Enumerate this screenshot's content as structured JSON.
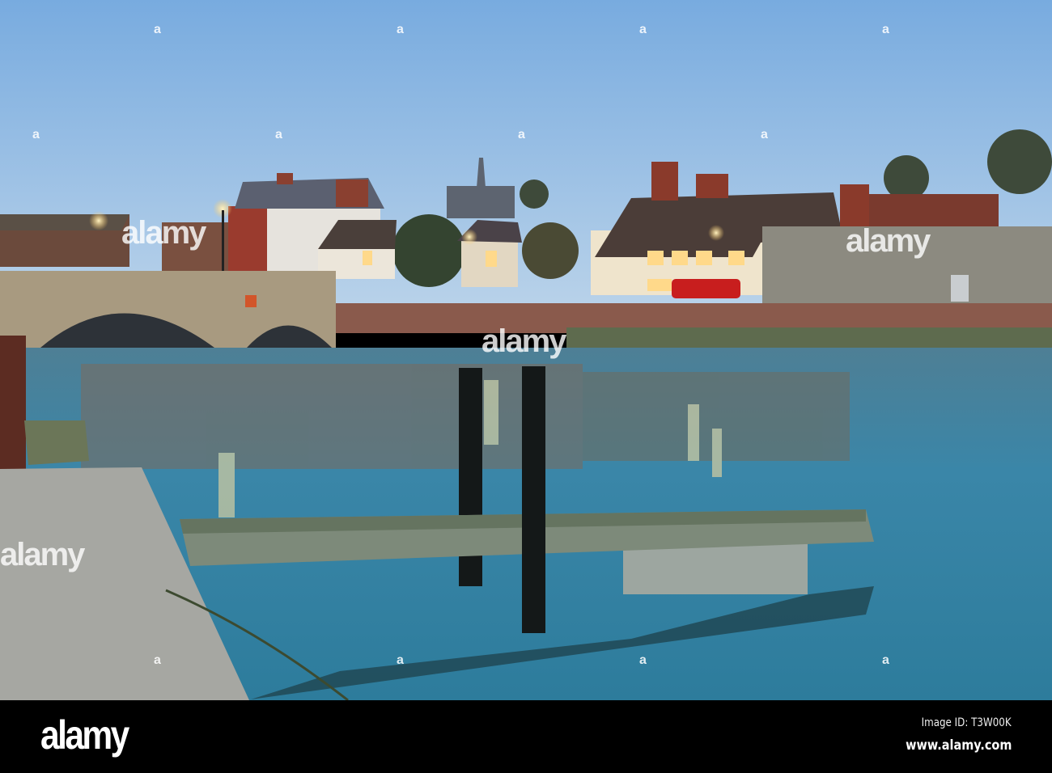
{
  "photo": {
    "subject": "River Arun at Arundel at dusk with bridge, half-timbered buildings and pontoon",
    "colors": {
      "sky_top": "#7fb0e0",
      "sky_bottom": "#b9d2ea",
      "water": "#2f7a96",
      "lamp": "#ffd98a"
    }
  },
  "watermark": {
    "text": "alamy",
    "mark": "a"
  },
  "footer": {
    "logo": "alamy",
    "image_id": "Image ID: T3W00K",
    "url": "www.alamy.com"
  }
}
